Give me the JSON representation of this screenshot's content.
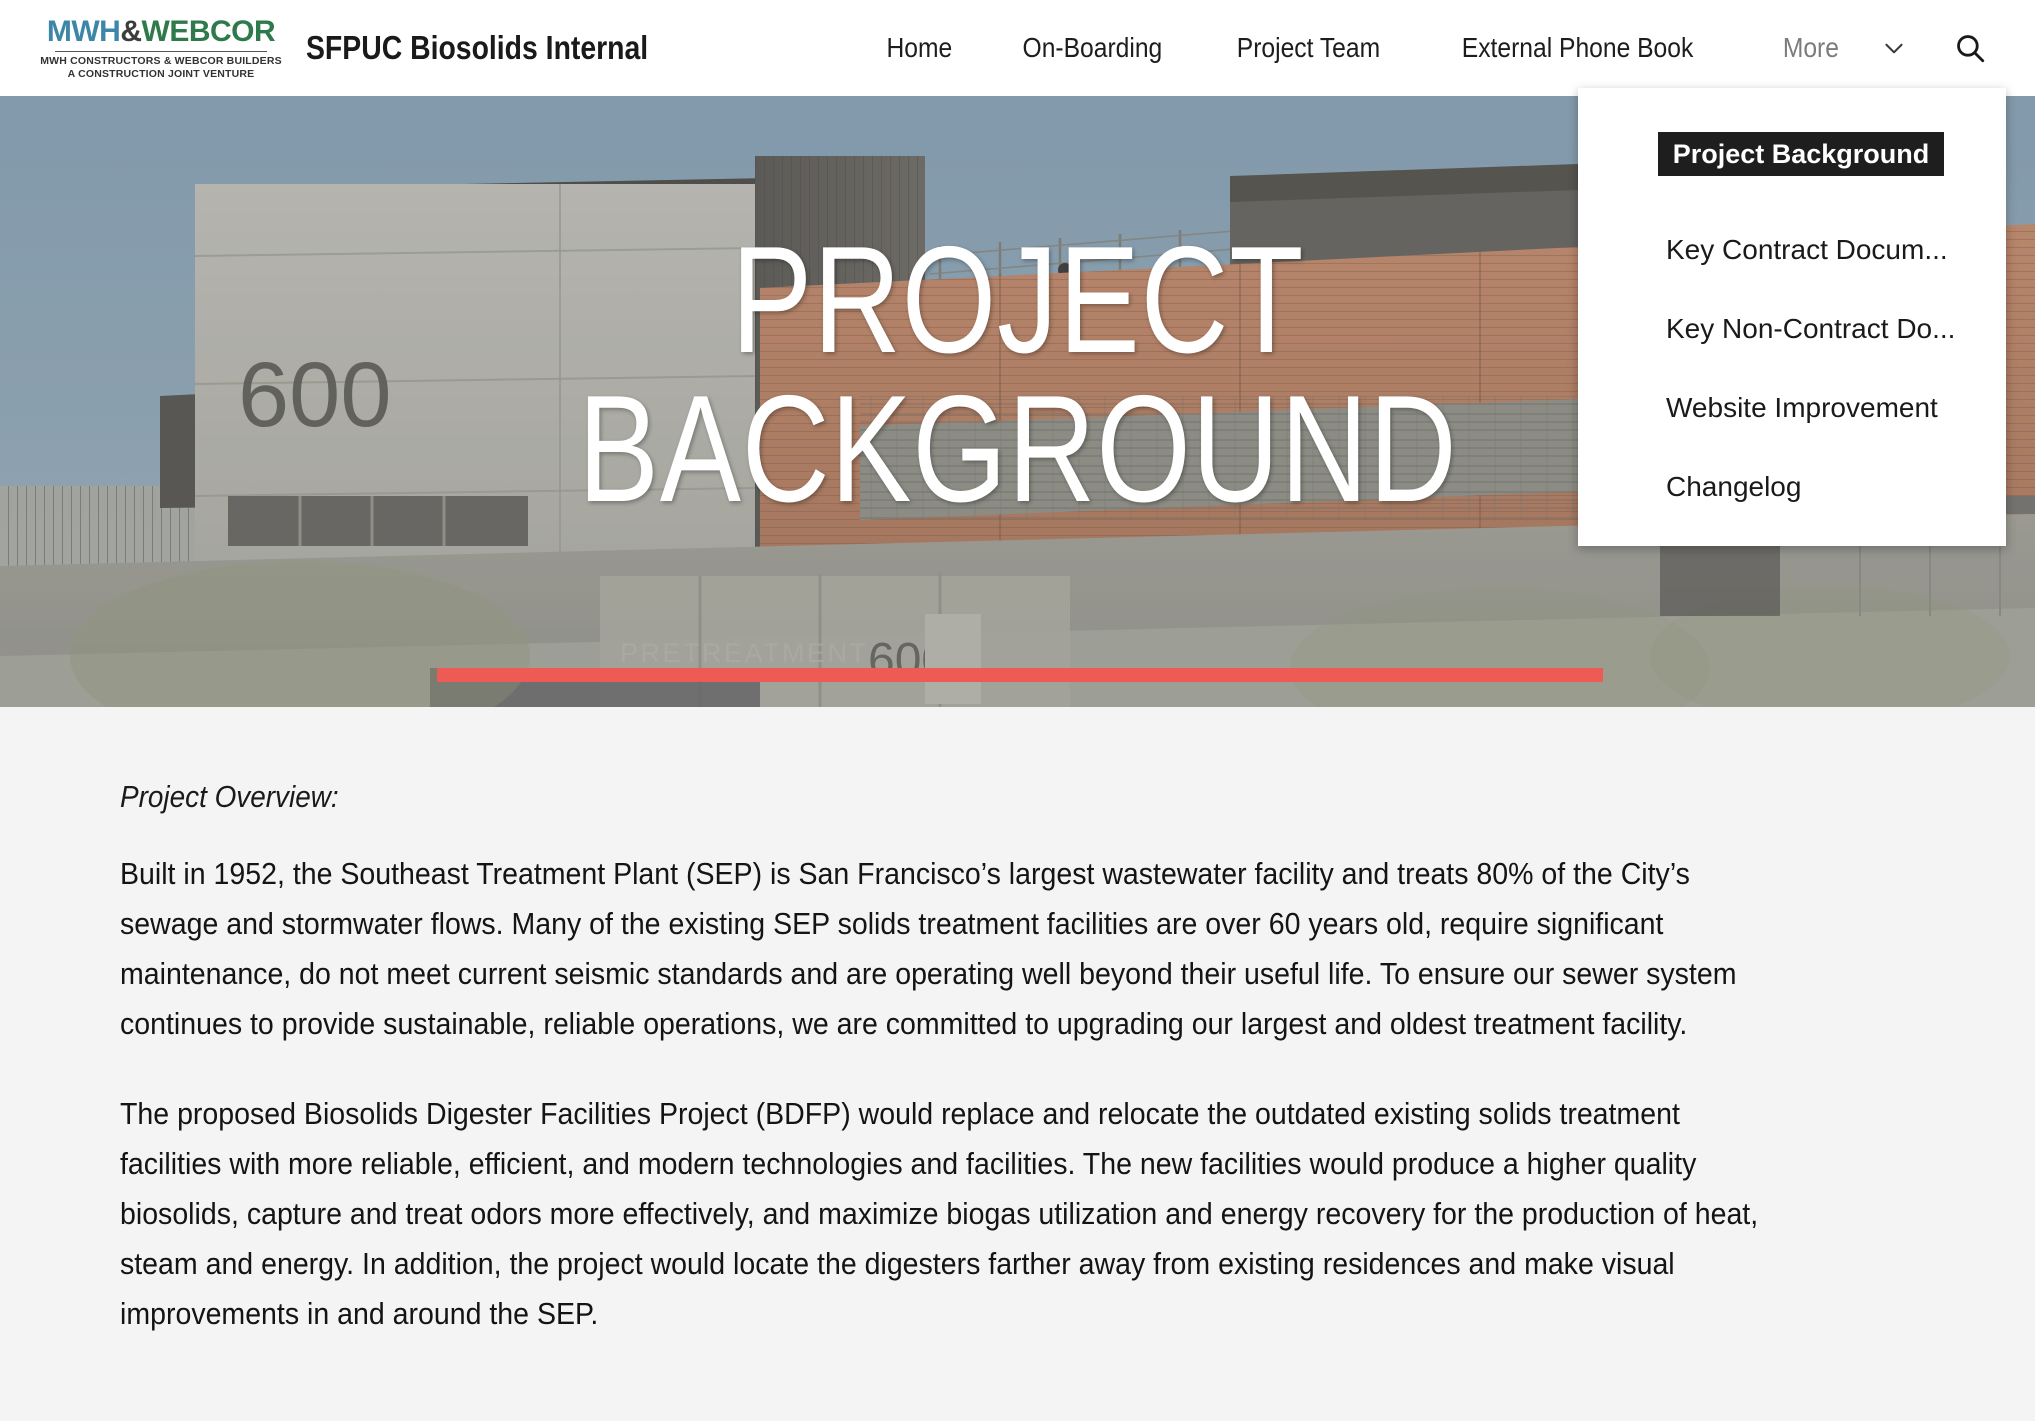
{
  "brand": {
    "logo_mwh": "MWH",
    "logo_amp": "&",
    "logo_webcor": "WEBCOR",
    "logo_sub_line1": "MWH CONSTRUCTORS & WEBCOR BUILDERS",
    "logo_sub_line2": "A CONSTRUCTION JOINT VENTURE",
    "site_title": "SFPUC Biosolids Internal"
  },
  "nav": {
    "items": [
      {
        "label": "Home",
        "icon": ""
      },
      {
        "label": "On-Boarding",
        "icon": ""
      },
      {
        "label": "Project Team",
        "icon": ""
      },
      {
        "label": "External Phone Book",
        "icon": ""
      }
    ],
    "more_label": "More",
    "chevron_icon": "chevron-down-icon",
    "search_icon": "search-icon"
  },
  "dropdown": {
    "items": [
      {
        "label": "Project Background",
        "active": true
      },
      {
        "label": "Key Contract Docum...",
        "active": false
      },
      {
        "label": "Key Non-Contract Do...",
        "active": false
      },
      {
        "label": "Website Improvement",
        "active": false
      },
      {
        "label": "Changelog",
        "active": false
      }
    ],
    "active_bg": "#1e1e1e",
    "active_fg": "#ffffff"
  },
  "hero": {
    "title_line1": "PROJECT",
    "title_line2": "BACKGROUND",
    "accent_color": "#ee5a54",
    "building_signage": "600",
    "building_label": "PRETREATMENT"
  },
  "main": {
    "overview_label": "Project Overview:",
    "paragraphs": [
      "Built in 1952, the Southeast Treatment Plant (SEP) is San Francisco’s largest wastewater facility and treats 80% of the City’s sewage and stormwater flows. Many of the existing SEP solids treatment facilities are over 60 years old, require significant maintenance, do not meet current seismic standards and are operating well beyond their useful life. To ensure our sewer system continues to provide sustainable, reliable operations, we are committed to upgrading our largest and oldest treatment facility.",
      "The proposed Biosolids Digester Facilities Project (BDFP) would replace and relocate the outdated existing solids treatment facilities with more reliable, efficient, and modern technologies and facilities. The new facilities would produce a higher quality biosolids, capture and treat odors more effectively, and maximize biogas utilization and energy recovery for the production of heat, steam and energy. In addition, the project would locate the digesters farther away from existing residences and make visual improvements in and around the SEP."
    ]
  }
}
